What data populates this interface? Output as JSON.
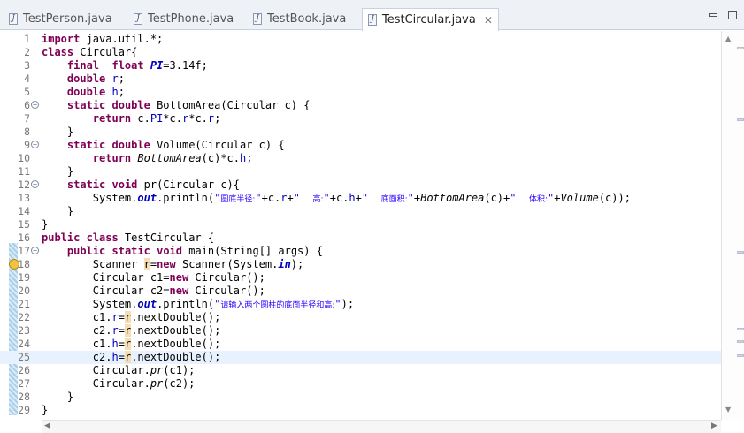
{
  "tabs": [
    {
      "label": "TestPerson.java",
      "active": false
    },
    {
      "label": "TestPhone.java",
      "active": false
    },
    {
      "label": "TestBook.java",
      "active": false
    },
    {
      "label": "TestCircular.java",
      "active": true
    }
  ],
  "editor": {
    "current_line": 25,
    "lines": [
      {
        "n": "1",
        "html": "<span class='kw'>import</span> java.util.*;"
      },
      {
        "n": "2",
        "html": "<span class='kw'>class</span> Circular{"
      },
      {
        "n": "3",
        "html": "    <span class='kw'>final</span>  <span class='kw'>float</span> <span class='sfld'>PI</span>=3.14f;"
      },
      {
        "n": "4",
        "html": "    <span class='kw'>double</span> <span class='fld'>r</span>;"
      },
      {
        "n": "5",
        "html": "    <span class='kw'>double</span> <span class='fld'>h</span>;"
      },
      {
        "n": "6",
        "fold": true,
        "html": "    <span class='kw'>static</span> <span class='kw'>double</span> BottomArea(Circular c) {"
      },
      {
        "n": "7",
        "html": "        <span class='kw'>return</span> c.<span class='fld'>PI</span>*c.<span class='fld'>r</span>*c.<span class='fld'>r</span>;"
      },
      {
        "n": "8",
        "html": "    }"
      },
      {
        "n": "9",
        "fold": true,
        "html": "    <span class='kw'>static</span> <span class='kw'>double</span> Volume(Circular c) {"
      },
      {
        "n": "10",
        "html": "        <span class='kw'>return</span> <span class='ital'>BottomArea</span>(c)*c.<span class='fld'>h</span>;"
      },
      {
        "n": "11",
        "html": "    }"
      },
      {
        "n": "12",
        "fold": true,
        "html": "    <span class='kw'>static</span> <span class='kw'>void</span> pr(Circular c){"
      },
      {
        "n": "13",
        "html": "        System.<span class='sfld'>out</span>.println(<span class='str'>\"<span class='cn'>圆底半径:</span>\"</span>+c.<span class='fld'>r</span>+<span class='str'>\"  <span class='cn'>高:</span>\"</span>+c.<span class='fld'>h</span>+<span class='str'>\"  <span class='cn'>底面积:</span>\"</span>+<span class='ital'>BottomArea</span>(c)+<span class='str'>\"  <span class='cn'>体积:</span>\"</span>+<span class='ital'>Volume</span>(c));"
      },
      {
        "n": "14",
        "html": "    }"
      },
      {
        "n": "15",
        "html": "}"
      },
      {
        "n": "16",
        "html": "<span class='kw'>public</span> <span class='kw'>class</span> TestCircular {"
      },
      {
        "n": "17",
        "fold": true,
        "html": "    <span class='kw'>public</span> <span class='kw'>static</span> <span class='kw'>void</span> main(String[] args) {"
      },
      {
        "n": "18",
        "warn": true,
        "html": "        Scanner <span class='occ'>r</span>=<span class='kw'>new</span> Scanner(System.<span class='sfld'>in</span>);"
      },
      {
        "n": "19",
        "html": "        Circular c1=<span class='kw'>new</span> Circular();"
      },
      {
        "n": "20",
        "html": "        Circular c2=<span class='kw'>new</span> Circular();"
      },
      {
        "n": "21",
        "html": "        System.<span class='sfld'>out</span>.println(<span class='str'>\"<span class='cn'>请输入两个圆柱的底面半径和高:</span>\"</span>);"
      },
      {
        "n": "22",
        "html": "        c1.<span class='fld'>r</span>=<span class='occ'>r</span>.nextDouble();"
      },
      {
        "n": "23",
        "html": "        c2.<span class='fld'>r</span>=<span class='occ'>r</span>.nextDouble();"
      },
      {
        "n": "24",
        "html": "        c1.<span class='fld'>h</span>=<span class='occ'>r</span>.nextDouble();"
      },
      {
        "n": "25",
        "html": "        c2.<span class='fld'>h</span>=<span class='occ'>r</span>.nextDouble();"
      },
      {
        "n": "26",
        "html": "        Circular.<span class='ital'>pr</span>(c1);"
      },
      {
        "n": "27",
        "html": "        Circular.<span class='ital'>pr</span>(c2);"
      },
      {
        "n": "28",
        "html": "    }"
      },
      {
        "n": "29",
        "html": "}"
      }
    ]
  },
  "icons": {
    "java_file": "java-file-icon",
    "close": "close-icon",
    "minimize": "minimize-icon",
    "maximize": "maximize-icon"
  }
}
